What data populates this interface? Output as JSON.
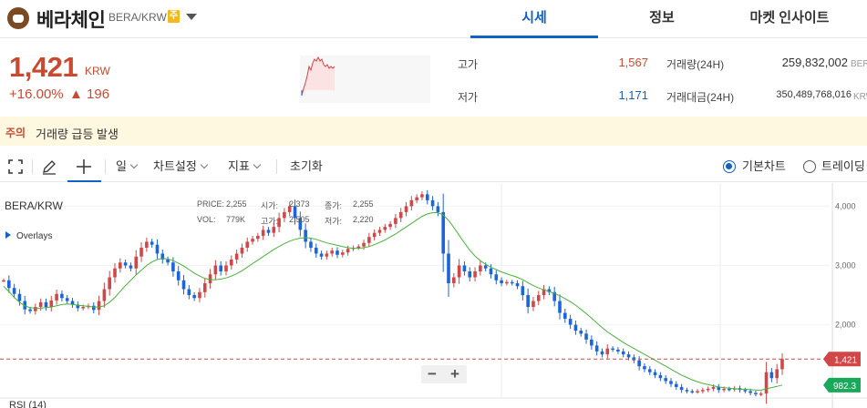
{
  "header": {
    "coin_name": "베라체인",
    "pair": "BERA/KRW",
    "warning_badge": "주",
    "tabs": [
      {
        "label": "시세",
        "active": true
      },
      {
        "label": "정보",
        "active": false
      },
      {
        "label": "마켓 인사이트",
        "active": false
      }
    ]
  },
  "price": {
    "current": "1,421",
    "unit": "KRW",
    "change_percent": "+16.00%",
    "change_abs": "▲ 196"
  },
  "stats": {
    "high_label": "고가",
    "high_value": "1,567",
    "low_label": "저가",
    "low_value": "1,171",
    "volume_label": "거래량(24H)",
    "volume_value": "259,832,002",
    "volume_unit": "BER",
    "amount_label": "거래대금(24H)",
    "amount_value": "350,489,768,016",
    "amount_unit": "KRW"
  },
  "notice": {
    "tag": "주의",
    "text": "거래량 급등 발생"
  },
  "toolbar": {
    "period": "일",
    "chart_settings": "차트설정",
    "indicators": "지표",
    "reset": "초기화",
    "basic_chart": "기본차트",
    "trading_view": "트레이딩"
  },
  "chart": {
    "pair": "BERA/KRW",
    "overlays": "Overlays",
    "info": {
      "price_label": "PRICE:",
      "price_value": "2,255",
      "open_label": "시가:",
      "open_value": "2,373",
      "close_label": "종가:",
      "close_value": "2,255",
      "vol_label": "VOL:",
      "vol_value": "779K",
      "high_label": "고가:",
      "high_value": "2,505",
      "low_label": "저가:",
      "low_value": "2,220"
    },
    "current_price_tag": "1,421",
    "ma_tag": "982.3",
    "rsi_label": "RSI (14)"
  },
  "chart_data": {
    "type": "candlestick",
    "y_ticks": [
      2000,
      3000,
      4000
    ],
    "ylim": [
      780,
      4390
    ],
    "current_price": 1421,
    "ma_value": 982.3,
    "colors": {
      "up": "#d14747",
      "down": "#1b64da",
      "ma": "#48b33a",
      "current_line": "#d14747",
      "ma_tag": "#1aa85a"
    },
    "series": [
      {
        "name": "close",
        "values": [
          2750,
          2620,
          2520,
          2400,
          2260,
          2230,
          2300,
          2380,
          2300,
          2410,
          2520,
          2450,
          2400,
          2340,
          2280,
          2300,
          2320,
          2250,
          2400,
          2600,
          2800,
          2950,
          3050,
          3000,
          2950,
          3150,
          3300,
          3400,
          3350,
          3200,
          3100,
          3050,
          2900,
          2750,
          2600,
          2500,
          2450,
          2550,
          2700,
          2850,
          3000,
          2900,
          3000,
          3100,
          3200,
          3300,
          3400,
          3450,
          3500,
          3600,
          3550,
          3650,
          3800,
          3900,
          4000,
          3800,
          3600,
          3400,
          3300,
          3200,
          3150,
          3200,
          3250,
          3180,
          3220,
          3280,
          3300,
          3320,
          3380,
          3480,
          3550,
          3600,
          3650,
          3700,
          3800,
          3900,
          4000,
          4100,
          4150,
          4200,
          4100,
          4000,
          3900,
          3200,
          2700,
          2800,
          3000,
          2900,
          2800,
          2900,
          3000,
          2950,
          2850,
          2750,
          2700,
          2720,
          2700,
          2650,
          2500,
          2300,
          2400,
          2500,
          2600,
          2550,
          2400,
          2200,
          2100,
          2000,
          1900,
          1850,
          1750,
          1650,
          1550,
          1500,
          1600,
          1580,
          1550,
          1500,
          1450,
          1400,
          1300,
          1250,
          1200,
          1150,
          1100,
          1050,
          1000,
          950,
          900,
          880,
          870,
          880,
          900,
          920,
          950,
          900,
          920,
          910,
          930,
          900,
          880,
          850,
          830,
          840,
          1200,
          1100,
          1250,
          1421
        ]
      },
      {
        "name": "MA",
        "values": [
          2650,
          2560,
          2460,
          2380,
          2320,
          2290,
          2280,
          2280,
          2290,
          2300,
          2320,
          2340,
          2350,
          2340,
          2330,
          2320,
          2310,
          2300,
          2300,
          2320,
          2380,
          2460,
          2560,
          2660,
          2750,
          2840,
          2920,
          3000,
          3060,
          3100,
          3120,
          3110,
          3080,
          3040,
          2990,
          2930,
          2870,
          2820,
          2780,
          2760,
          2760,
          2770,
          2790,
          2820,
          2860,
          2910,
          2970,
          3030,
          3090,
          3150,
          3210,
          3270,
          3320,
          3370,
          3410,
          3440,
          3460,
          3470,
          3460,
          3440,
          3410,
          3380,
          3360,
          3340,
          3320,
          3300,
          3290,
          3290,
          3300,
          3320,
          3350,
          3390,
          3430,
          3480,
          3530,
          3590,
          3650,
          3710,
          3770,
          3830,
          3870,
          3890,
          3890,
          3850,
          3760,
          3640,
          3510,
          3380,
          3260,
          3160,
          3080,
          3020,
          2970,
          2930,
          2890,
          2860,
          2830,
          2800,
          2760,
          2710,
          2660,
          2620,
          2590,
          2560,
          2530,
          2490,
          2440,
          2390,
          2330,
          2260,
          2190,
          2110,
          2030,
          1950,
          1880,
          1820,
          1760,
          1700,
          1650,
          1600,
          1550,
          1500,
          1450,
          1400,
          1350,
          1300,
          1250,
          1200,
          1150,
          1110,
          1070,
          1040,
          1010,
          990,
          970,
          950,
          940,
          930,
          920,
          915,
          910,
          905,
          900,
          895,
          920,
          940,
          960,
          982.3
        ]
      }
    ]
  }
}
